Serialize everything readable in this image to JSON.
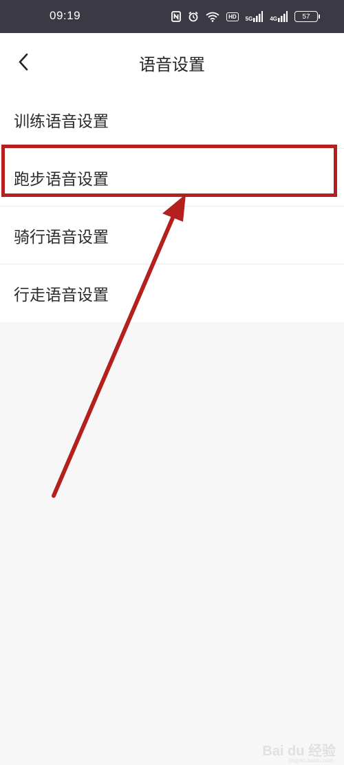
{
  "status_bar": {
    "time": "09:19",
    "net_5g": "5G",
    "net_4g": "4G",
    "hd": "HD",
    "battery": "57"
  },
  "header": {
    "title": "语音设置"
  },
  "menu": {
    "items": [
      {
        "label": "训练语音设置"
      },
      {
        "label": "跑步语音设置"
      },
      {
        "label": "骑行语音设置"
      },
      {
        "label": "行走语音设置"
      }
    ]
  },
  "annotation": {
    "color": "#b3201d"
  },
  "watermark": {
    "logo": "Bai du 经验",
    "site": "jingyan.baidu.com"
  }
}
